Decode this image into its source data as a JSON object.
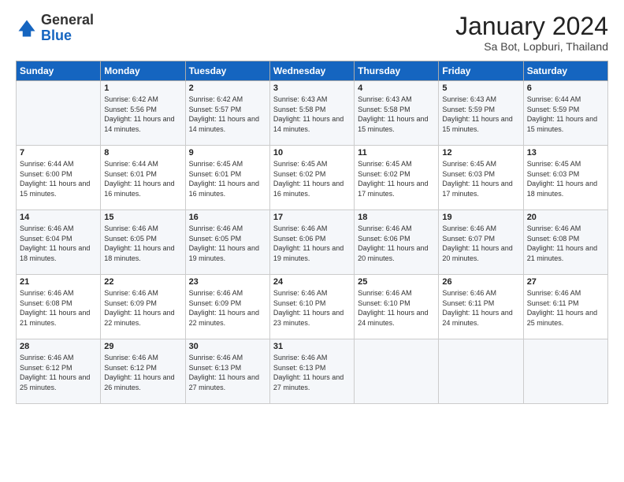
{
  "header": {
    "logo_general": "General",
    "logo_blue": "Blue",
    "month_title": "January 2024",
    "subtitle": "Sa Bot, Lopburi, Thailand"
  },
  "columns": [
    "Sunday",
    "Monday",
    "Tuesday",
    "Wednesday",
    "Thursday",
    "Friday",
    "Saturday"
  ],
  "weeks": [
    [
      {
        "day": "",
        "sunrise": "",
        "sunset": "",
        "daylight": ""
      },
      {
        "day": "1",
        "sunrise": "Sunrise: 6:42 AM",
        "sunset": "Sunset: 5:56 PM",
        "daylight": "Daylight: 11 hours and 14 minutes."
      },
      {
        "day": "2",
        "sunrise": "Sunrise: 6:42 AM",
        "sunset": "Sunset: 5:57 PM",
        "daylight": "Daylight: 11 hours and 14 minutes."
      },
      {
        "day": "3",
        "sunrise": "Sunrise: 6:43 AM",
        "sunset": "Sunset: 5:58 PM",
        "daylight": "Daylight: 11 hours and 14 minutes."
      },
      {
        "day": "4",
        "sunrise": "Sunrise: 6:43 AM",
        "sunset": "Sunset: 5:58 PM",
        "daylight": "Daylight: 11 hours and 15 minutes."
      },
      {
        "day": "5",
        "sunrise": "Sunrise: 6:43 AM",
        "sunset": "Sunset: 5:59 PM",
        "daylight": "Daylight: 11 hours and 15 minutes."
      },
      {
        "day": "6",
        "sunrise": "Sunrise: 6:44 AM",
        "sunset": "Sunset: 5:59 PM",
        "daylight": "Daylight: 11 hours and 15 minutes."
      }
    ],
    [
      {
        "day": "7",
        "sunrise": "Sunrise: 6:44 AM",
        "sunset": "Sunset: 6:00 PM",
        "daylight": "Daylight: 11 hours and 15 minutes."
      },
      {
        "day": "8",
        "sunrise": "Sunrise: 6:44 AM",
        "sunset": "Sunset: 6:01 PM",
        "daylight": "Daylight: 11 hours and 16 minutes."
      },
      {
        "day": "9",
        "sunrise": "Sunrise: 6:45 AM",
        "sunset": "Sunset: 6:01 PM",
        "daylight": "Daylight: 11 hours and 16 minutes."
      },
      {
        "day": "10",
        "sunrise": "Sunrise: 6:45 AM",
        "sunset": "Sunset: 6:02 PM",
        "daylight": "Daylight: 11 hours and 16 minutes."
      },
      {
        "day": "11",
        "sunrise": "Sunrise: 6:45 AM",
        "sunset": "Sunset: 6:02 PM",
        "daylight": "Daylight: 11 hours and 17 minutes."
      },
      {
        "day": "12",
        "sunrise": "Sunrise: 6:45 AM",
        "sunset": "Sunset: 6:03 PM",
        "daylight": "Daylight: 11 hours and 17 minutes."
      },
      {
        "day": "13",
        "sunrise": "Sunrise: 6:45 AM",
        "sunset": "Sunset: 6:03 PM",
        "daylight": "Daylight: 11 hours and 18 minutes."
      }
    ],
    [
      {
        "day": "14",
        "sunrise": "Sunrise: 6:46 AM",
        "sunset": "Sunset: 6:04 PM",
        "daylight": "Daylight: 11 hours and 18 minutes."
      },
      {
        "day": "15",
        "sunrise": "Sunrise: 6:46 AM",
        "sunset": "Sunset: 6:05 PM",
        "daylight": "Daylight: 11 hours and 18 minutes."
      },
      {
        "day": "16",
        "sunrise": "Sunrise: 6:46 AM",
        "sunset": "Sunset: 6:05 PM",
        "daylight": "Daylight: 11 hours and 19 minutes."
      },
      {
        "day": "17",
        "sunrise": "Sunrise: 6:46 AM",
        "sunset": "Sunset: 6:06 PM",
        "daylight": "Daylight: 11 hours and 19 minutes."
      },
      {
        "day": "18",
        "sunrise": "Sunrise: 6:46 AM",
        "sunset": "Sunset: 6:06 PM",
        "daylight": "Daylight: 11 hours and 20 minutes."
      },
      {
        "day": "19",
        "sunrise": "Sunrise: 6:46 AM",
        "sunset": "Sunset: 6:07 PM",
        "daylight": "Daylight: 11 hours and 20 minutes."
      },
      {
        "day": "20",
        "sunrise": "Sunrise: 6:46 AM",
        "sunset": "Sunset: 6:08 PM",
        "daylight": "Daylight: 11 hours and 21 minutes."
      }
    ],
    [
      {
        "day": "21",
        "sunrise": "Sunrise: 6:46 AM",
        "sunset": "Sunset: 6:08 PM",
        "daylight": "Daylight: 11 hours and 21 minutes."
      },
      {
        "day": "22",
        "sunrise": "Sunrise: 6:46 AM",
        "sunset": "Sunset: 6:09 PM",
        "daylight": "Daylight: 11 hours and 22 minutes."
      },
      {
        "day": "23",
        "sunrise": "Sunrise: 6:46 AM",
        "sunset": "Sunset: 6:09 PM",
        "daylight": "Daylight: 11 hours and 22 minutes."
      },
      {
        "day": "24",
        "sunrise": "Sunrise: 6:46 AM",
        "sunset": "Sunset: 6:10 PM",
        "daylight": "Daylight: 11 hours and 23 minutes."
      },
      {
        "day": "25",
        "sunrise": "Sunrise: 6:46 AM",
        "sunset": "Sunset: 6:10 PM",
        "daylight": "Daylight: 11 hours and 24 minutes."
      },
      {
        "day": "26",
        "sunrise": "Sunrise: 6:46 AM",
        "sunset": "Sunset: 6:11 PM",
        "daylight": "Daylight: 11 hours and 24 minutes."
      },
      {
        "day": "27",
        "sunrise": "Sunrise: 6:46 AM",
        "sunset": "Sunset: 6:11 PM",
        "daylight": "Daylight: 11 hours and 25 minutes."
      }
    ],
    [
      {
        "day": "28",
        "sunrise": "Sunrise: 6:46 AM",
        "sunset": "Sunset: 6:12 PM",
        "daylight": "Daylight: 11 hours and 25 minutes."
      },
      {
        "day": "29",
        "sunrise": "Sunrise: 6:46 AM",
        "sunset": "Sunset: 6:12 PM",
        "daylight": "Daylight: 11 hours and 26 minutes."
      },
      {
        "day": "30",
        "sunrise": "Sunrise: 6:46 AM",
        "sunset": "Sunset: 6:13 PM",
        "daylight": "Daylight: 11 hours and 27 minutes."
      },
      {
        "day": "31",
        "sunrise": "Sunrise: 6:46 AM",
        "sunset": "Sunset: 6:13 PM",
        "daylight": "Daylight: 11 hours and 27 minutes."
      },
      {
        "day": "",
        "sunrise": "",
        "sunset": "",
        "daylight": ""
      },
      {
        "day": "",
        "sunrise": "",
        "sunset": "",
        "daylight": ""
      },
      {
        "day": "",
        "sunrise": "",
        "sunset": "",
        "daylight": ""
      }
    ]
  ]
}
